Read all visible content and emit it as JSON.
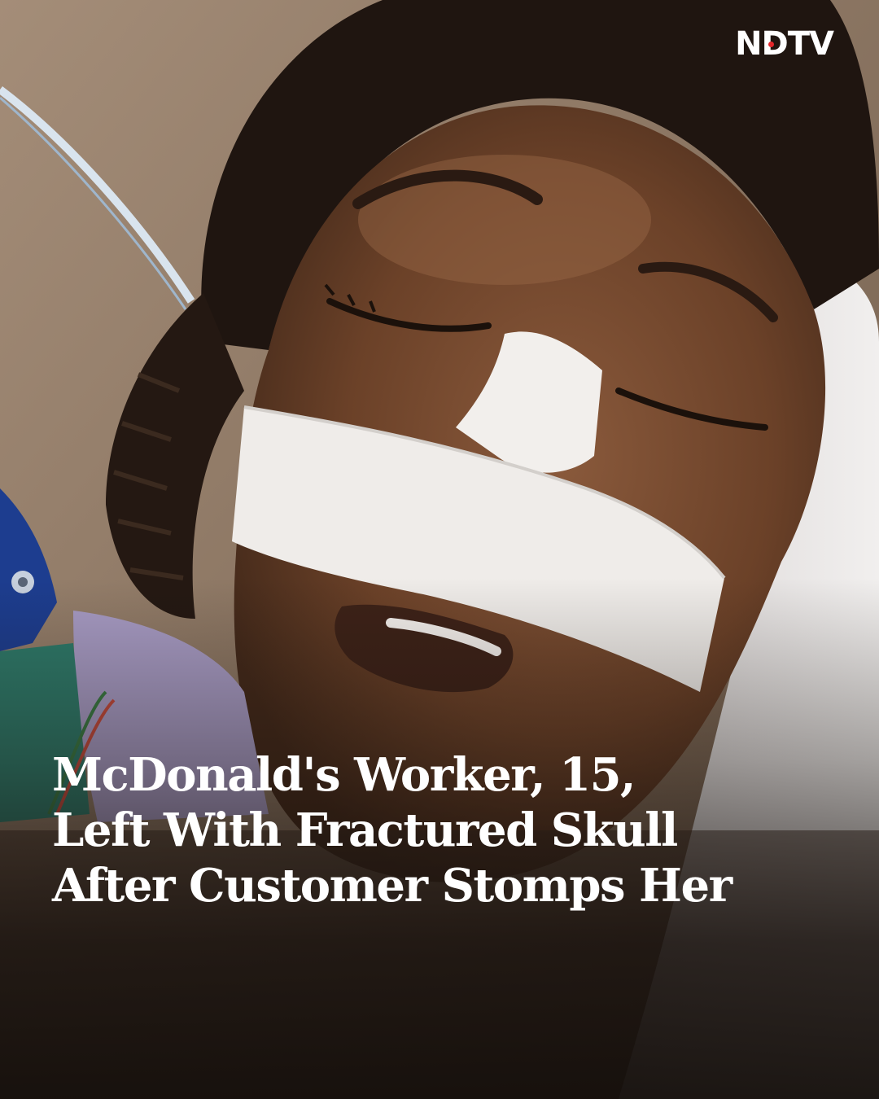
{
  "brand": {
    "logo_text": "NDTV",
    "accent_color": "#e3262a"
  },
  "headline": {
    "lines": [
      "McDonald's Worker, 15,",
      "Left With Fractured Skull",
      "After Customer Stomps Her"
    ],
    "color": "#ffffff"
  }
}
